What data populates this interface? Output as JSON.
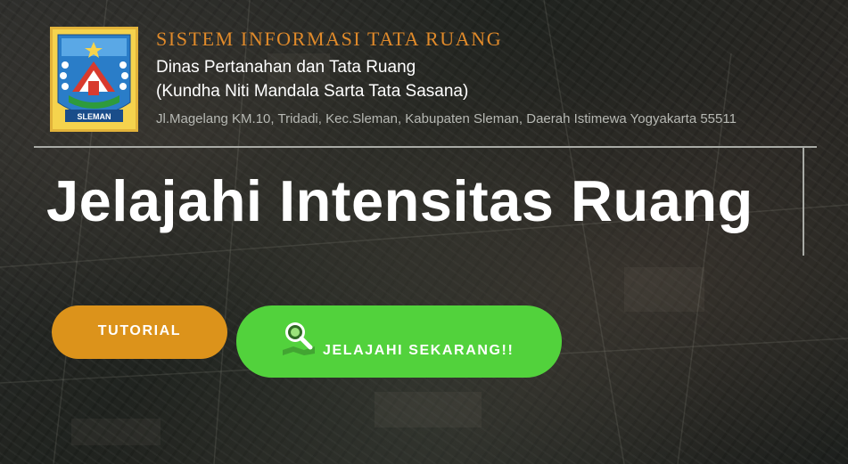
{
  "header": {
    "logo_text": "SLEMAN",
    "app_title": "SISTEM INFORMASI TATA RUANG",
    "agency_name": "Dinas Pertanahan dan Tata Ruang",
    "agency_subname": "(Kundha Niti Mandala Sarta Tata Sasana)",
    "address": "Jl.Magelang KM.10, Tridadi, Kec.Sleman, Kabupaten Sleman, Daerah Istimewa Yogyakarta 55511"
  },
  "hero": {
    "title": "Jelajahi Intensitas Ruang"
  },
  "buttons": {
    "tutorial_label": "TUTORIAL",
    "explore_label": "JELAJAHI SEKARANG!!",
    "explore_icon": "map-search-icon"
  },
  "colors": {
    "title_orange": "#e08a2a",
    "tutorial_button": "#dc931b",
    "explore_button": "#52d23c",
    "divider": "#a8aaa5"
  }
}
